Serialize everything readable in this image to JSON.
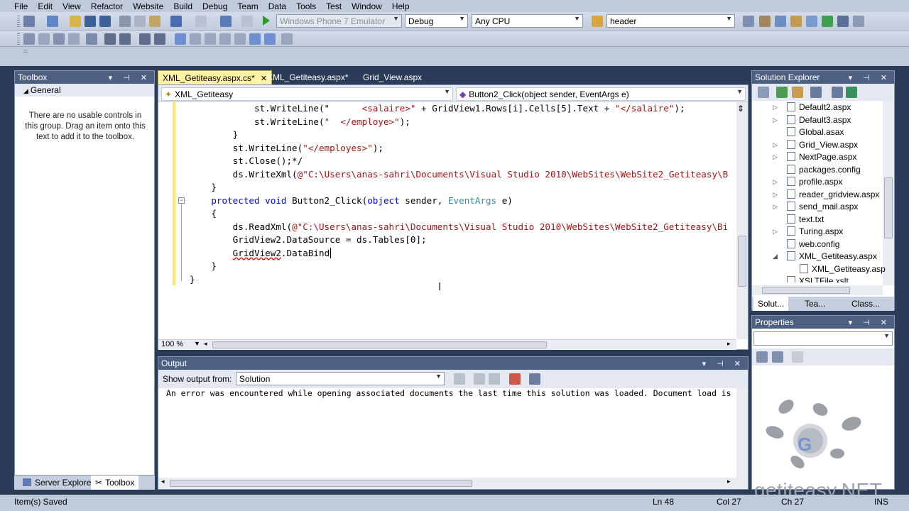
{
  "menu": [
    "File",
    "Edit",
    "View",
    "Refactor",
    "Website",
    "Build",
    "Debug",
    "Team",
    "Data",
    "Tools",
    "Test",
    "Window",
    "Help"
  ],
  "toolbar": {
    "device_target": "Windows Phone 7 Emulator",
    "configuration": "Debug",
    "platform": "Any CPU",
    "find": "header"
  },
  "toolbox": {
    "title": "Toolbox",
    "group": "General",
    "empty_message": "There are no usable controls in this group. Drag an item onto this text to add it to the toolbox.",
    "bottom_tabs": [
      "Server Explorer",
      "Toolbox"
    ]
  },
  "editor": {
    "tabs": [
      "XML_Getiteasy.aspx.cs*",
      "XML_Getiteasy.aspx*",
      "Grid_View.aspx"
    ],
    "class_nav": "XML_Getiteasy",
    "member_nav": "Button2_Click(object sender, EventArgs e)",
    "zoom": "100 %",
    "lines": [
      [
        {
          "t": "            st.WriteLine(\"      "
        },
        {
          "c": "str",
          "t": "<salaire>\""
        },
        {
          "t": " + GridView1.Rows[i].Cells[5].Text + "
        },
        {
          "c": "str",
          "t": "\"</salaire\""
        },
        {
          "t": ");"
        }
      ],
      [
        {
          "t": "            st.WriteLine("
        },
        {
          "c": "str",
          "t": "\"  </employe>\""
        },
        {
          "t": ");"
        }
      ],
      [
        {
          "t": "        }"
        }
      ],
      [
        {
          "t": "        st.WriteLine("
        },
        {
          "c": "str",
          "t": "\"</employes>\""
        },
        {
          "t": ");"
        }
      ],
      [
        {
          "t": "        st.Close();*/"
        }
      ],
      [
        {
          "t": "        ds.WriteXml("
        },
        {
          "c": "str",
          "t": "@\"C:\\Users\\anas-sahri\\Documents\\Visual Studio 2010\\WebSites\\WebSite2_Getiteasy\\B"
        }
      ],
      [
        {
          "t": "    }"
        }
      ],
      [
        {
          "c": "kw",
          "t": "    protected void "
        },
        {
          "t": "Button2_Click("
        },
        {
          "c": "kw",
          "t": "object"
        },
        {
          "t": " sender, "
        },
        {
          "c": "typ",
          "t": "EventArgs"
        },
        {
          "t": " e)"
        }
      ],
      [
        {
          "t": "    {"
        }
      ],
      [
        {
          "t": "        ds.ReadXml("
        },
        {
          "c": "str",
          "t": "@\"C:\\Users\\anas-sahri\\Documents\\Visual Studio 2010\\WebSites\\WebSite2_Getiteasy\\Bi"
        }
      ],
      [
        {
          "t": "        GridView2.DataSource = ds.Tables[0];"
        }
      ],
      [
        {
          "t": "        "
        },
        {
          "c": "sq",
          "t": "GridView2"
        },
        {
          "t": ".DataBind"
        }
      ],
      [
        {
          "t": "    }"
        }
      ],
      [
        {
          "t": "}"
        }
      ]
    ]
  },
  "output": {
    "title": "Output",
    "show_from_label": "Show output from:",
    "source": "Solution",
    "message": "An error was encountered while opening associated documents the last time this solution was loaded. Document load is b"
  },
  "solution_explorer": {
    "title": "Solution Explorer",
    "items": [
      "Default2.aspx",
      "Default3.aspx",
      "Global.asax",
      "Grid_View.aspx",
      "NextPage.aspx",
      "packages.config",
      "profile.aspx",
      "reader_gridview.aspx",
      "send_mail.aspx",
      "text.txt",
      "Turing.aspx",
      "web.config",
      "XML_Getiteasy.aspx",
      "XML_Getiteasy.asp",
      "XSLTFile.xslt"
    ],
    "bottom_tabs": [
      "Solut...",
      "Tea...",
      "Class..."
    ]
  },
  "properties": {
    "title": "Properties"
  },
  "watermark": "getiteasy.NET",
  "status": {
    "message": "Item(s) Saved",
    "ln": "Ln 48",
    "col": "Col 27",
    "ch": "Ch 27",
    "mode": "INS"
  },
  "colors": {
    "chrome": "#2b3c59",
    "panel_head": "#4d6082",
    "active_tab": "#fff3a8"
  }
}
